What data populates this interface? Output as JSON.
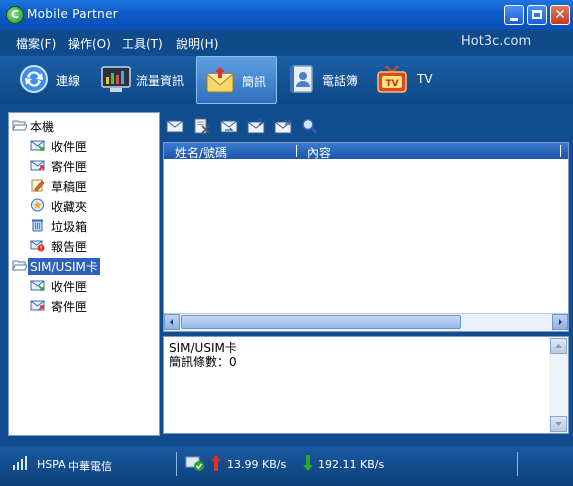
{
  "window": {
    "title": "Mobile Partner",
    "app_icon_letter": "C"
  },
  "menu": {
    "items": [
      "檔案(F)",
      "操作(O)",
      "工具(T)",
      "說明(H)"
    ],
    "brand": "Hot3c.com"
  },
  "toolbar": {
    "connect": "連線",
    "traffic": "流量資訊",
    "sms": "簡訊",
    "phonebook": "電話簿",
    "tv": "TV",
    "active": "sms"
  },
  "tree": {
    "local": {
      "label": "本機",
      "items": [
        "收件匣",
        "寄件匣",
        "草稿匣",
        "收藏夾",
        "垃圾箱",
        "報告匣"
      ]
    },
    "sim": {
      "label": "SIM/USIM卡",
      "items": [
        "收件匣",
        "寄件匣"
      ]
    }
  },
  "grid": {
    "columns": [
      "姓名/號碼",
      "內容"
    ]
  },
  "info": {
    "location": "SIM/USIM卡",
    "count_text": "簡訊條數：0"
  },
  "status": {
    "network": "HSPA",
    "carrier": "中華電信",
    "upload": "13.99 KB/s",
    "download": "192.11 KB/s"
  },
  "colors": {
    "accent": "#2f62b6",
    "upload_arrow": "#e0321f",
    "download_arrow": "#2ea52a"
  }
}
